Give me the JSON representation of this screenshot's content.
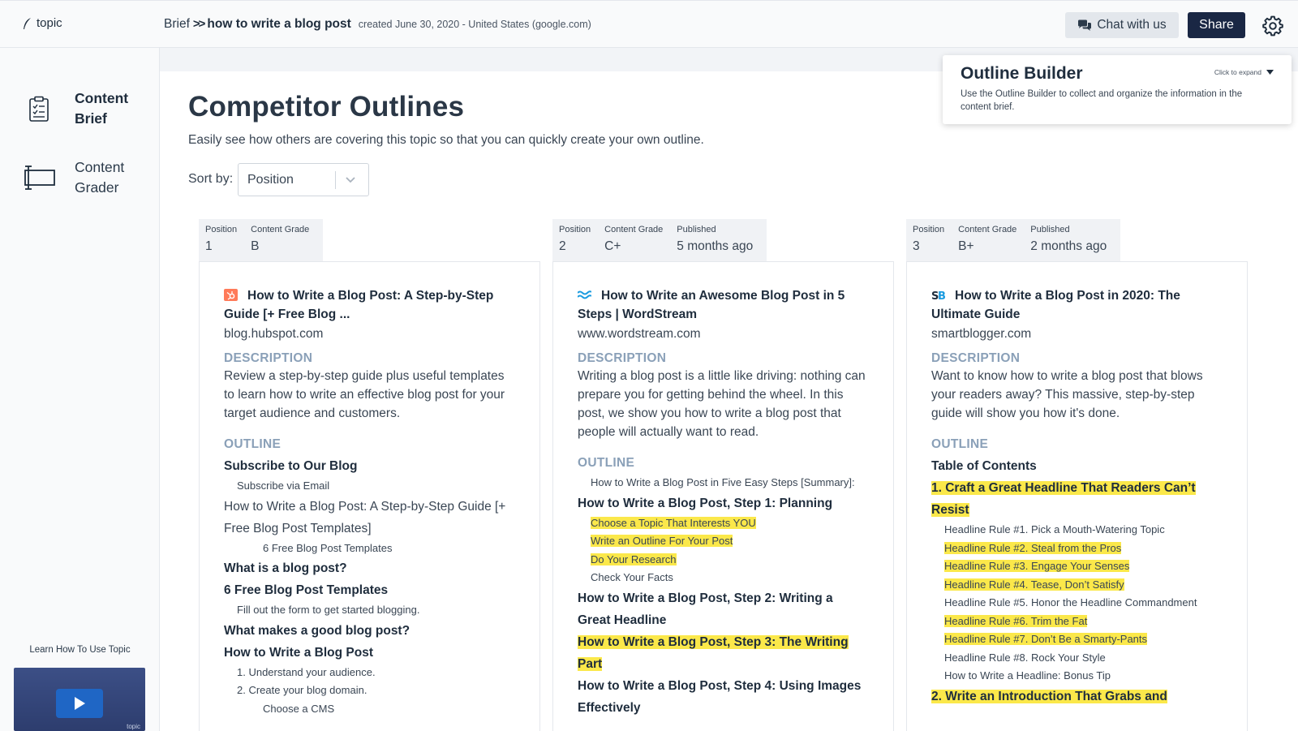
{
  "app": {
    "logo_text": "topic"
  },
  "breadcrumb": {
    "root": "Brief",
    "separator": ">>",
    "current": "how to write a blog post",
    "meta": "created June 30, 2020 - United States (google.com)"
  },
  "topbar": {
    "chat_label": "Chat with us",
    "share_label": "Share"
  },
  "sidebar": {
    "items": [
      {
        "label": "Content Brief",
        "active": true
      },
      {
        "label": "Content Grader",
        "active": false
      }
    ],
    "learn_label": "Learn How To Use Topic",
    "video_brand": "topic"
  },
  "main": {
    "title": "Competitor Outlines",
    "subtitle": "Easily see how others are covering this topic so that you can quickly create your own outline.",
    "sort_label": "Sort by:",
    "sort_value": "Position"
  },
  "builder": {
    "title": "Outline Builder",
    "description": "Use the Outline Builder to collect and organize the information in the content brief.",
    "expand_label": "Click to expand"
  },
  "labels": {
    "position": "Position",
    "content_grade": "Content Grade",
    "published": "Published",
    "description": "DESCRIPTION",
    "outline": "OUTLINE"
  },
  "colors": {
    "brand_navy": "#1a2744",
    "highlight": "#fbe84a",
    "section_head": "#8aa0b8"
  },
  "competitors": [
    {
      "position": "1",
      "grade": "B",
      "published": "",
      "favicon": "hubspot-icon",
      "title": "How to Write a Blog Post: A Step-by-Step Guide [+ Free Blog ...",
      "domain": "blog.hubspot.com",
      "description": "Review a step-by-step guide plus useful templates to learn how to write an effective blog post for your target audience and customers.",
      "outline": [
        {
          "level": "h2",
          "text": "Subscribe to Our Blog",
          "hl": false
        },
        {
          "level": "h3",
          "text": "Subscribe via Email",
          "hl": false
        },
        {
          "level": "t",
          "text": "How to Write a Blog Post: A Step-by-Step Guide [+ Free Blog Post Templates]",
          "hl": false
        },
        {
          "level": "h4",
          "text": "6 Free Blog Post Templates",
          "hl": false
        },
        {
          "level": "h2",
          "text": "What is a blog post?",
          "hl": false
        },
        {
          "level": "h2",
          "text": "6 Free Blog Post Templates",
          "hl": false
        },
        {
          "level": "h3",
          "text": "Fill out the form to get started blogging.",
          "hl": false
        },
        {
          "level": "h2",
          "text": "What makes a good blog post?",
          "hl": false
        },
        {
          "level": "h2",
          "text": "How to Write a Blog Post",
          "hl": false
        },
        {
          "level": "h3",
          "text": "1. Understand your audience.",
          "hl": false
        },
        {
          "level": "h3",
          "text": "2. Create your blog domain.",
          "hl": false
        },
        {
          "level": "h4",
          "text": "Choose a CMS",
          "hl": false
        }
      ]
    },
    {
      "position": "2",
      "grade": "C+",
      "published": "5 months ago",
      "favicon": "wordstream-icon",
      "title": "How to Write an Awesome Blog Post in 5 Steps | WordStream",
      "domain": "www.wordstream.com",
      "description": "Writing a blog post is a little like driving: nothing can prepare you for getting behind the wheel. In this post, we show you how to write a blog post that people will actually want to read.",
      "outline": [
        {
          "level": "h3",
          "text": "How to Write a Blog Post in Five Easy Steps [Summary]:",
          "hl": false
        },
        {
          "level": "h2",
          "text": "How to Write a Blog Post, Step 1: Planning",
          "hl": false
        },
        {
          "level": "h3",
          "text": "Choose a Topic That Interests YOU",
          "hl": true
        },
        {
          "level": "h3",
          "text": "Write an Outline For Your Post",
          "hl": true
        },
        {
          "level": "h3",
          "text": "Do Your Research",
          "hl": true
        },
        {
          "level": "h3",
          "text": "Check Your Facts",
          "hl": false
        },
        {
          "level": "h2",
          "text": "How to Write a Blog Post, Step 2: Writing a Great Headline",
          "hl": false
        },
        {
          "level": "h2",
          "text": "How to Write a Blog Post, Step 3: The Writing Part",
          "hl": true
        },
        {
          "level": "h2",
          "text": "How to Write a Blog Post, Step 4: Using Images Effectively",
          "hl": false
        }
      ]
    },
    {
      "position": "3",
      "grade": "B+",
      "published": "2 months ago",
      "favicon": "smartblogger-icon",
      "title": "How to Write a Blog Post in 2020: The Ultimate Guide",
      "domain": "smartblogger.com",
      "description": "Want to know how to write a blog post that blows your readers away? This massive, step-by-step guide will show you how it's done.",
      "outline": [
        {
          "level": "h2",
          "text": "Table of Contents",
          "hl": false
        },
        {
          "level": "h2",
          "text": "1. Craft a Great Headline That Readers Can’t Resist",
          "hl": true
        },
        {
          "level": "h3",
          "text": "Headline Rule #1. Pick a Mouth-Watering Topic",
          "hl": false
        },
        {
          "level": "h3",
          "text": "Headline Rule #2. Steal from the Pros",
          "hl": true
        },
        {
          "level": "h3",
          "text": "Headline Rule #3. Engage Your Senses",
          "hl": true
        },
        {
          "level": "h3",
          "text": "Headline Rule #4. Tease, Don’t Satisfy",
          "hl": true
        },
        {
          "level": "h3",
          "text": "Headline Rule #5. Honor the Headline Commandment",
          "hl": false
        },
        {
          "level": "h3",
          "text": "Headline Rule #6. Trim the Fat",
          "hl": true
        },
        {
          "level": "h3",
          "text": "Headline Rule #7. Don’t Be a Smarty-Pants",
          "hl": true
        },
        {
          "level": "h3",
          "text": "Headline Rule #8. Rock Your Style",
          "hl": false
        },
        {
          "level": "h3",
          "text": "How to Write a Headline: Bonus Tip",
          "hl": false
        },
        {
          "level": "h2",
          "text": "2. Write an Introduction That Grabs and",
          "hl": true
        }
      ]
    }
  ]
}
